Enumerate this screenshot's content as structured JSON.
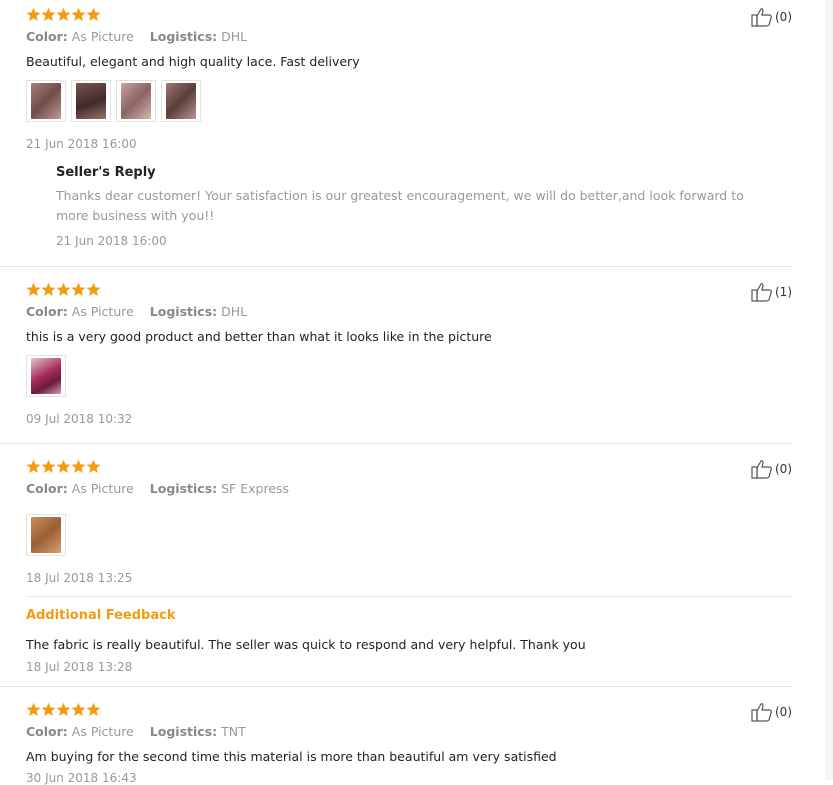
{
  "colors": {
    "star": "#f39c12",
    "accent": "#f39c12",
    "muted": "#999999"
  },
  "icons": {
    "star": "star-icon",
    "like": "thumbs-up-icon"
  },
  "reviews": [
    {
      "color_label": "Color:",
      "color_value": "As Picture",
      "logistics_label": "Logistics:",
      "logistics_value": "DHL",
      "text": "Beautiful, elegant and high quality lace. Fast delivery",
      "date": "21 Jun 2018 16:00",
      "likes": "(0)",
      "rating": 5,
      "seller_reply": {
        "title": "Seller's Reply",
        "text": "Thanks dear customer! Your satisfaction is our greatest encouragement, we will do better,and look forward to more business with you!!",
        "date": "21 Jun 2018 16:00"
      }
    },
    {
      "color_label": "Color:",
      "color_value": "As Picture",
      "logistics_label": "Logistics:",
      "logistics_value": "DHL",
      "text": "this is a very good product and better than what it looks like in the picture",
      "date": "09 Jul 2018 10:32",
      "likes": "(1)",
      "rating": 5
    },
    {
      "color_label": "Color:",
      "color_value": "As Picture",
      "logistics_label": "Logistics:",
      "logistics_value": "SF Express",
      "date": "18 Jul 2018 13:25",
      "likes": "(0)",
      "rating": 5,
      "additional_feedback": {
        "title": "Additional Feedback",
        "text": "The fabric is really beautiful. The seller was quick to respond and very helpful. Thank you",
        "date": "18 Jul 2018 13:28"
      }
    },
    {
      "color_label": "Color:",
      "color_value": "As Picture",
      "logistics_label": "Logistics:",
      "logistics_value": "TNT",
      "text": "Am buying for the second time this material is more than beautiful am very satisfied",
      "date": "30 Jun 2018 16:43",
      "likes": "(0)",
      "rating": 5
    }
  ]
}
